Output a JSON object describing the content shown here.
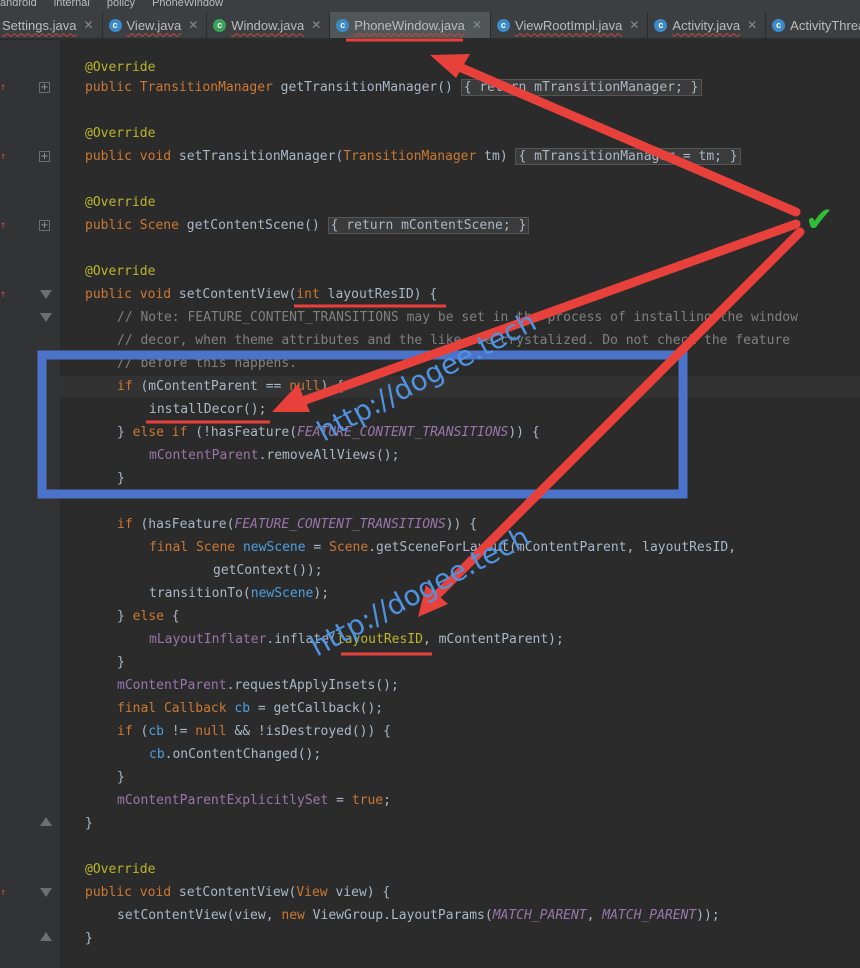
{
  "breadcrumbs": [
    "android",
    "internal",
    "policy",
    "PhoneWindow"
  ],
  "tabs": [
    {
      "label": "Settings.java",
      "icon": "c",
      "active": false
    },
    {
      "label": "View.java",
      "icon": "c",
      "active": false
    },
    {
      "label": "Window.java",
      "icon": "c",
      "active": false
    },
    {
      "label": "PhoneWindow.java",
      "icon": "c",
      "active": true
    },
    {
      "label": "ViewRootImpl.java",
      "icon": "c",
      "active": false
    },
    {
      "label": "Activity.java",
      "icon": "c",
      "active": false
    },
    {
      "label": "ActivityThread",
      "icon": "c",
      "active": false
    }
  ],
  "code": {
    "ann_override": "@Override",
    "l1": "public",
    "l1b": "TransitionManager",
    "l1c": " getTransitionManager() ",
    "l1d": "{ return mTransitionManager; }",
    "l2": "public void",
    "l2b": " setTransitionManager(",
    "l2c": "TransitionManager",
    "l2d": " tm) ",
    "l2e": "{ mTransitionManager = tm; }",
    "l3": "public",
    "l3b": "Scene",
    "l3c": " getContentScene() ",
    "l3d": "{ return mContentScene; }",
    "l4": "public void",
    "l4b": " setContentView(",
    "l4c": "int",
    "l4d": " layoutResID) {",
    "c1": "// Note: FEATURE_CONTENT_TRANSITIONS may be set in the process of installing the window",
    "c2": "// decor, when theme attributes and the like are crystalized. Do not check the feature",
    "c3": "// before this happens.",
    "s1a": "if",
    "s1b": " (mContentParent == ",
    "s1c": "null",
    "s1d": ") {",
    "s2": "installDecor();",
    "s3a": "} ",
    "s3b": "else if",
    "s3c": " (!hasFeature(",
    "s3d": "FEATURE_CONTENT_TRANSITIONS",
    "s3e": ")) {",
    "s4a": "mContentParent",
    "s4b": ".removeAllViews();",
    "s5": "}",
    "s6a": "if",
    "s6b": " (hasFeature(",
    "s6c": "FEATURE_CONTENT_TRANSITIONS",
    "s6d": ")) {",
    "s7a": "final",
    "s7b": "Scene",
    "s7c": "newScene",
    "s7d": " = ",
    "s7e": "Scene",
    "s7f": ".getSceneForLayout(mContentParent, layoutResID,",
    "s8": "getContext());",
    "s9a": "transitionTo(",
    "s9b": "newScene",
    "s9c": ");",
    "s10a": "} ",
    "s10b": "else",
    "s10c": " {",
    "s11a": "mLayoutInflater",
    "s11b": ".inflate(",
    "s11c": "layoutResID",
    "s11d": ", mContentParent);",
    "s12": "}",
    "s13a": "mContentParent",
    "s13b": ".requestApplyInsets();",
    "s14a": "final",
    "s14b": "Callback",
    "s14c": "cb",
    "s14d": " = getCallback();",
    "s15a": "if",
    "s15b": " (",
    "s15c": "cb",
    "s15d": " != ",
    "s15e": "null",
    "s15f": " && !isDestroyed()) {",
    "s16a": "cb",
    "s16b": ".onContentChanged();",
    "s17": "}",
    "s18a": "mContentParentExplicitlySet",
    "s18b": " = ",
    "s18c": "true",
    "s18d": ";",
    "s19": "}",
    "l5": "public void",
    "l5b": " setContentView(",
    "l5c": "View",
    "l5d": " view) {",
    "s20a": "setContentView(view, ",
    "s20b": "new",
    "s20c": " ViewGroup.LayoutParams(",
    "s20d": "MATCH_PARENT",
    "s20e": ", ",
    "s20f": "MATCH_PARENT",
    "s20g": "));",
    "s21": "}"
  },
  "annotations": {
    "watermark": "http://dogee.tech",
    "checkmark": "✔",
    "colors": {
      "arrow": "#e8413b",
      "box": "#4a73c9",
      "check": "#2fbf35"
    }
  }
}
